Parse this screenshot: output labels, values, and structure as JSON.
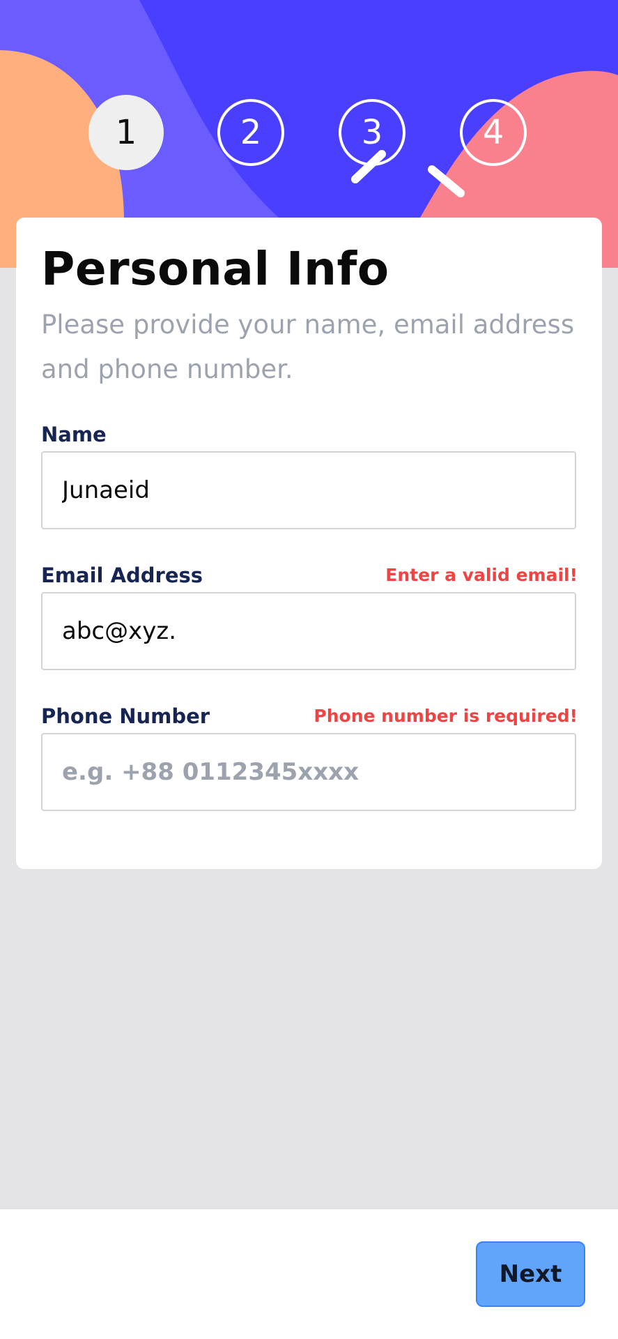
{
  "colors": {
    "hero_primary": "#4a3fff",
    "hero_secondary": "#6a5cff",
    "blob_orange": "#ffaf7e",
    "blob_pink": "#f9818e",
    "page_background": "#e4e4e7",
    "error": "#ef4444",
    "label": "#172554",
    "next_button": "#60a5fa"
  },
  "steps": [
    "1",
    "2",
    "3",
    "4"
  ],
  "form": {
    "title": "Personal Info",
    "subtitle": "Please provide your name, email address and phone number.",
    "name": {
      "label": "Name",
      "value": "Junaeid"
    },
    "email": {
      "label": "Email Address",
      "value": "abc@xyz.",
      "error": "Enter a valid email!"
    },
    "phone": {
      "label": "Phone Number",
      "value": "",
      "placeholder": "e.g. +88 0112345xxxx",
      "error": "Phone number is required!"
    }
  },
  "footer": {
    "next_label": "Next"
  }
}
